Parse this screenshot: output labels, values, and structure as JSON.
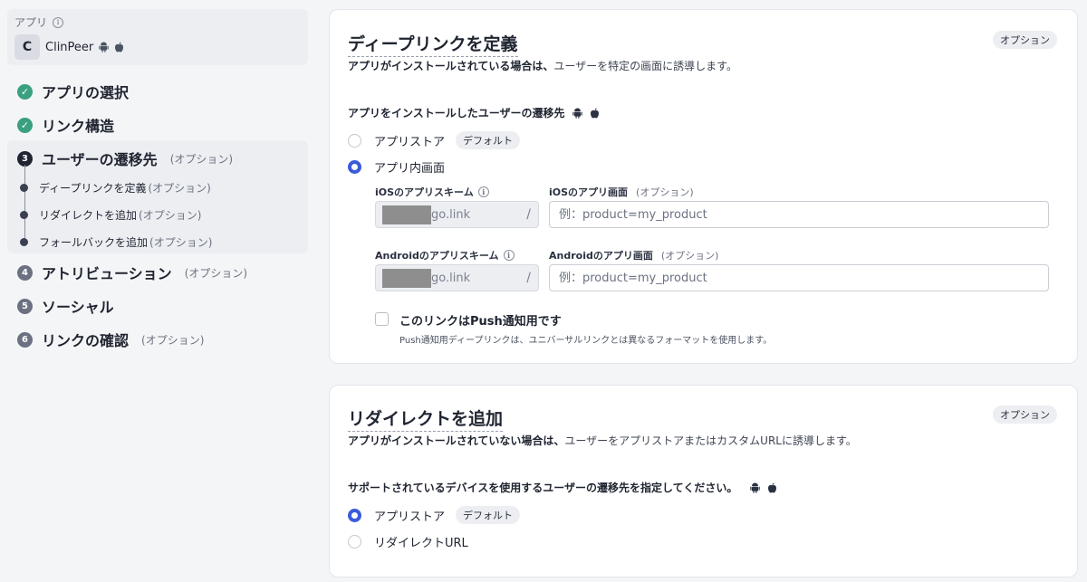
{
  "sidebar": {
    "app_label": "アプリ",
    "app_initial": "C",
    "app_name": "ClinPeer",
    "steps": [
      {
        "label": "アプリの選択",
        "state": "done",
        "optional": ""
      },
      {
        "label": "リンク構造",
        "state": "done",
        "optional": ""
      },
      {
        "number": "3",
        "label": "ユーザーの遷移先",
        "state": "active",
        "optional": "(オプション)"
      },
      {
        "number": "4",
        "label": "アトリビューション",
        "state": "pending",
        "optional": "(オプション)"
      },
      {
        "number": "5",
        "label": "ソーシャル",
        "state": "pending",
        "optional": ""
      },
      {
        "number": "6",
        "label": "リンクの確認",
        "state": "pending",
        "optional": "(オプション)"
      }
    ],
    "substeps": [
      {
        "label": "ディープリンクを定義",
        "optional": "(オプション)"
      },
      {
        "label": "リダイレクトを追加",
        "optional": "(オプション)"
      },
      {
        "label": "フォールバックを追加",
        "optional": "(オプション)"
      }
    ]
  },
  "deeplink_card": {
    "title": "ディープリンクを定義",
    "badge": "オプション",
    "desc_bold": "アプリがインストールされている場合は、",
    "desc_rest": "ユーザーを特定の画面に誘導します。",
    "section_label": "アプリをインストールしたユーザーの遷移先",
    "options": [
      {
        "label": "アプリストア",
        "tag": "デフォルト",
        "selected": false
      },
      {
        "label": "アプリ内画面",
        "tag": "",
        "selected": true
      }
    ],
    "ios_scheme_label": "iOSのアプリスキーム",
    "ios_scheme_value": "go.link",
    "ios_screen_label": "iOSのアプリ画面",
    "ios_screen_optional": "(オプション)",
    "ios_screen_placeholder": "例：product=my_product",
    "android_scheme_label": "Androidのアプリスキーム",
    "android_scheme_value": "go.link",
    "android_screen_label": "Androidのアプリ画面",
    "android_screen_optional": "(オプション)",
    "android_screen_placeholder": "例：product=my_product",
    "slash": "/",
    "push_label": "このリンクはPush通知用です",
    "push_help": "Push通知用ディープリンクは、ユニバーサルリンクとは異なるフォーマットを使用します。",
    "push_checked": false
  },
  "redirect_card": {
    "title": "リダイレクトを追加",
    "badge": "オプション",
    "desc_bold": "アプリがインストールされていない場合は、",
    "desc_rest": "ユーザーをアプリストアまたはカスタムURLに誘導します。",
    "section_label": "サポートされているデバイスを使用するユーザーの遷移先を指定してください。",
    "options": [
      {
        "label": "アプリストア",
        "tag": "デフォルト",
        "selected": true
      },
      {
        "label": "リダイレクトURL",
        "tag": "",
        "selected": false
      }
    ]
  },
  "icons": {
    "android": "android-icon",
    "apple": "apple-icon",
    "info": "info-icon",
    "check": "check-icon"
  },
  "colors": {
    "accent": "#3b5bdb",
    "done": "#3aa07f",
    "active": "#1f2430"
  }
}
